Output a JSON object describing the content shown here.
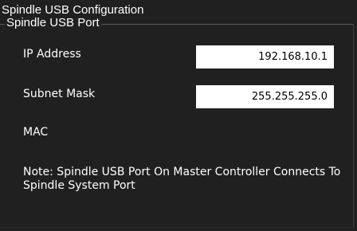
{
  "window": {
    "title": "Spindle USB Configuration"
  },
  "group": {
    "title": "Spindle USB Port"
  },
  "fields": {
    "ip_address": {
      "label": "IP Address",
      "value": "192.168.10.1"
    },
    "subnet_mask": {
      "label": "Subnet Mask",
      "value": "255.255.255.0"
    },
    "mac": {
      "label": "MAC"
    }
  },
  "note": "Note: Spindle USB Port On Master Controller Connects To Spindle System Port",
  "colors": {
    "background": "#202020",
    "text": "#ffffff",
    "input_background": "#ffffff",
    "input_text": "#000000"
  }
}
